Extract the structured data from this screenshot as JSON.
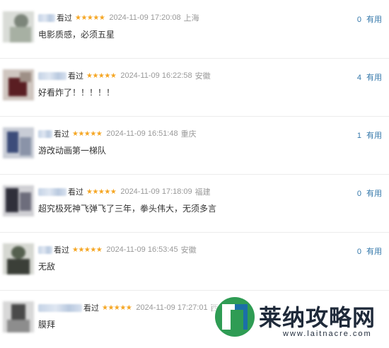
{
  "comments": [
    {
      "watched": "看过",
      "stars": "★★★★★",
      "time": "2024-11-09 17:20:08",
      "location": "上海",
      "text": "电影质感，必须五星",
      "votes": "0",
      "useful_label": "有用"
    },
    {
      "watched": "看过",
      "stars": "★★★★★",
      "time": "2024-11-09 16:22:58",
      "location": "安徽",
      "text": "好看炸了！！！！！",
      "votes": "4",
      "useful_label": "有用"
    },
    {
      "watched": "看过",
      "stars": "★★★★★",
      "time": "2024-11-09 16:51:48",
      "location": "重庆",
      "text": "游改动画第一梯队",
      "votes": "1",
      "useful_label": "有用"
    },
    {
      "watched": "看过",
      "stars": "★★★★★",
      "time": "2024-11-09 17:18:09",
      "location": "福建",
      "text": "超究极死神飞弹飞了三年，拳头伟大，无须多言",
      "votes": "0",
      "useful_label": "有用"
    },
    {
      "watched": "看过",
      "stars": "★★★★★",
      "time": "2024-11-09 16:53:45",
      "location": "安徽",
      "text": "无敌",
      "votes": "0",
      "useful_label": "有用"
    },
    {
      "watched": "看过",
      "stars": "★★★★★",
      "time": "2024-11-09 17:27:01",
      "location": "西",
      "text": "膜拜",
      "votes": "",
      "useful_label": ""
    }
  ],
  "watermark": {
    "title": "莱纳攻略网",
    "url": "www.laitnacre.com"
  },
  "colors": {
    "star": "#f5a623",
    "link": "#3377aa",
    "text": "#333333",
    "meta": "#999999"
  }
}
